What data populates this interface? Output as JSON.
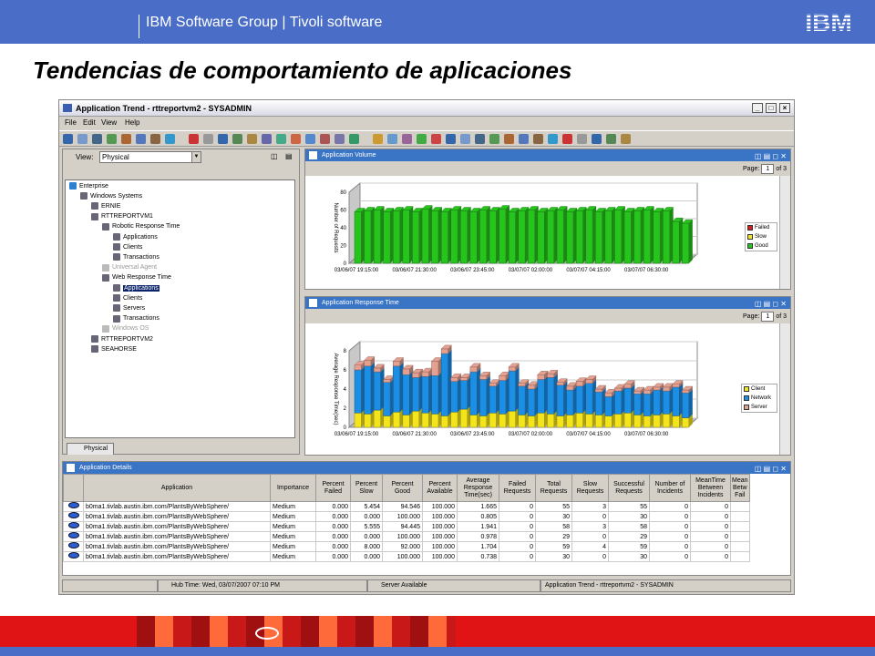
{
  "slide": {
    "header_text": "IBM Software Group | Tivoli software",
    "logo_text": "IBM",
    "title": "Tendencias de comportamiento de aplicaciones",
    "header_color": "#4a6ec7",
    "footer_color": "#e01414"
  },
  "window": {
    "title": "Application Trend - rttreportvm2 - SYSADMIN",
    "controls": [
      "_",
      "□",
      "×"
    ],
    "menu": [
      "File",
      "Edit",
      "View",
      "Help"
    ]
  },
  "navigator": {
    "view_label": "View:",
    "view_value": "Physical",
    "tab_label": "Physical",
    "tree": [
      {
        "label": "Enterprise",
        "level": 0
      },
      {
        "label": "Windows Systems",
        "level": 1
      },
      {
        "label": "ERNIE",
        "level": 2
      },
      {
        "label": "RTTREPORTVM1",
        "level": 2
      },
      {
        "label": "Robotic Response Time",
        "level": 3
      },
      {
        "label": "Applications",
        "level": 4
      },
      {
        "label": "Clients",
        "level": 4
      },
      {
        "label": "Transactions",
        "level": 4
      },
      {
        "label": "Universal Agent",
        "level": 3,
        "dim": true
      },
      {
        "label": "Web Response Time",
        "level": 3
      },
      {
        "label": "Applications",
        "level": 4,
        "selected": true
      },
      {
        "label": "Clients",
        "level": 4
      },
      {
        "label": "Servers",
        "level": 4
      },
      {
        "label": "Transactions",
        "level": 4
      },
      {
        "label": "Windows OS",
        "level": 3,
        "dim": true
      },
      {
        "label": "RTTREPORTVM2",
        "level": 2
      },
      {
        "label": "SEAHORSE",
        "level": 2
      }
    ]
  },
  "volume_panel": {
    "title": "Application Volume",
    "page_label": "Page:",
    "page_value": "1",
    "page_of": "of 3"
  },
  "response_panel": {
    "title": "Application Response Time",
    "page_label": "Page:",
    "page_value": "1",
    "page_of": "of 3"
  },
  "chart_data": [
    {
      "type": "bar",
      "ylabel": "Number of Requests",
      "ylim": [
        0,
        80
      ],
      "yticks": [
        "0",
        "20",
        "40",
        "60",
        "80"
      ],
      "xticks": [
        "03/06/07 19:15:00",
        "03/06/07 21:30:00",
        "03/06/07 23:45:00",
        "03/07/07 02:00:00",
        "03/07/07 04:15:00",
        "03/07/07 06:30:00"
      ],
      "legend": [
        "Failed",
        "Slow",
        "Good"
      ],
      "colors": {
        "Failed": "#d81c1c",
        "Slow": "#f4e41c",
        "Good": "#26c41c"
      },
      "series": [
        {
          "name": "Good",
          "values": [
            58,
            59,
            60,
            58,
            59,
            60,
            58,
            61,
            59,
            58,
            60,
            59,
            58,
            60,
            59,
            61,
            58,
            59,
            60,
            58,
            59,
            60,
            58,
            59,
            60,
            58,
            59,
            60,
            58,
            59,
            60,
            58,
            59,
            47,
            45
          ]
        }
      ]
    },
    {
      "type": "bar",
      "ylabel": "Average Response Time(sec)",
      "ylim": [
        0,
        8
      ],
      "yticks": [
        "0",
        "2",
        "4",
        "6",
        "8"
      ],
      "xticks": [
        "03/06/07 19:15:00",
        "03/06/07 21:30:00",
        "03/06/07 23:45:00",
        "03/07/07 02:00:00",
        "03/07/07 04:15:00",
        "03/07/07 06:30:00"
      ],
      "legend": [
        "Client",
        "Network",
        "Server"
      ],
      "colors": {
        "Client": "#f4e41c",
        "Network": "#1c8ee4",
        "Server": "#e4a090"
      },
      "series": [
        {
          "name": "Client",
          "values": [
            1.5,
            1.4,
            1.8,
            1.2,
            1.6,
            1.3,
            1.7,
            1.5,
            1.4,
            1.2,
            1.6,
            1.9,
            1.3,
            1.2,
            1.5,
            1.4,
            1.7,
            1.3,
            1.2,
            1.5,
            1.4,
            1.2,
            1.3,
            1.5,
            1.4,
            1.3,
            1.2,
            1.4,
            1.5,
            1.3,
            1.2,
            1.3,
            1.4,
            1.2,
            1.0
          ]
        },
        {
          "name": "Network",
          "values": [
            4.5,
            5.0,
            4.0,
            3.5,
            4.8,
            4.2,
            3.5,
            3.8,
            4.0,
            6.5,
            3.2,
            3.0,
            4.5,
            3.8,
            2.8,
            3.5,
            4.2,
            3.0,
            2.8,
            3.5,
            3.8,
            3.2,
            2.6,
            2.8,
            3.2,
            2.4,
            2.0,
            2.4,
            2.6,
            2.2,
            2.3,
            2.6,
            2.4,
            3.0,
            2.6
          ]
        },
        {
          "name": "Server",
          "values": [
            0.5,
            0.6,
            0.4,
            0.3,
            0.5,
            0.6,
            0.5,
            0.5,
            1.5,
            0.5,
            0.4,
            0.3,
            0.5,
            0.4,
            0.3,
            0.5,
            0.4,
            0.3,
            0.4,
            0.5,
            0.4,
            0.3,
            0.4,
            0.5,
            0.4,
            0.3,
            0.4,
            0.3,
            0.4,
            0.3,
            0.4,
            0.3,
            0.4,
            0.3,
            0.3
          ]
        }
      ]
    }
  ],
  "details": {
    "title": "Application Details",
    "columns": [
      "Application",
      "Importance",
      "Percent Failed",
      "Percent Slow",
      "Percent Good",
      "Percent Available",
      "Average Response Time(sec)",
      "Failed Requests",
      "Total Requests",
      "Slow Requests",
      "Successful Requests",
      "Number of Incidents",
      "MeanTime Between Incidents",
      "Mean Betw Fail"
    ],
    "rows": [
      [
        "b0ma1.tivlab.austin.ibm.com/PlantsByWebSphere/",
        "Medium",
        "0.000",
        "5.454",
        "94.546",
        "100.000",
        "1.665",
        "0",
        "55",
        "3",
        "55",
        "0",
        "0"
      ],
      [
        "b0ma1.tivlab.austin.ibm.com/PlantsByWebSphere/",
        "Medium",
        "0.000",
        "0.000",
        "100.000",
        "100.000",
        "0.805",
        "0",
        "30",
        "0",
        "30",
        "0",
        "0"
      ],
      [
        "b0ma1.tivlab.austin.ibm.com/PlantsByWebSphere/",
        "Medium",
        "0.000",
        "5.555",
        "94.445",
        "100.000",
        "1.941",
        "0",
        "58",
        "3",
        "58",
        "0",
        "0"
      ],
      [
        "b0ma1.tivlab.austin.ibm.com/PlantsByWebSphere/",
        "Medium",
        "0.000",
        "0.000",
        "100.000",
        "100.000",
        "0.978",
        "0",
        "29",
        "0",
        "29",
        "0",
        "0"
      ],
      [
        "b0ma1.tivlab.austin.ibm.com/PlantsByWebSphere/",
        "Medium",
        "0.000",
        "8.000",
        "92.000",
        "100.000",
        "1.704",
        "0",
        "59",
        "4",
        "59",
        "0",
        "0"
      ],
      [
        "b0ma1.tivlab.austin.ibm.com/PlantsByWebSphere/",
        "Medium",
        "0.000",
        "0.000",
        "100.000",
        "100.000",
        "0.738",
        "0",
        "30",
        "0",
        "30",
        "0",
        "0"
      ]
    ]
  },
  "status": {
    "hub_time": "Hub Time: Wed, 03/07/2007 07:10 PM",
    "server": "Server Available",
    "window": "Application Trend - rttreportvm2 - SYSADMIN"
  }
}
